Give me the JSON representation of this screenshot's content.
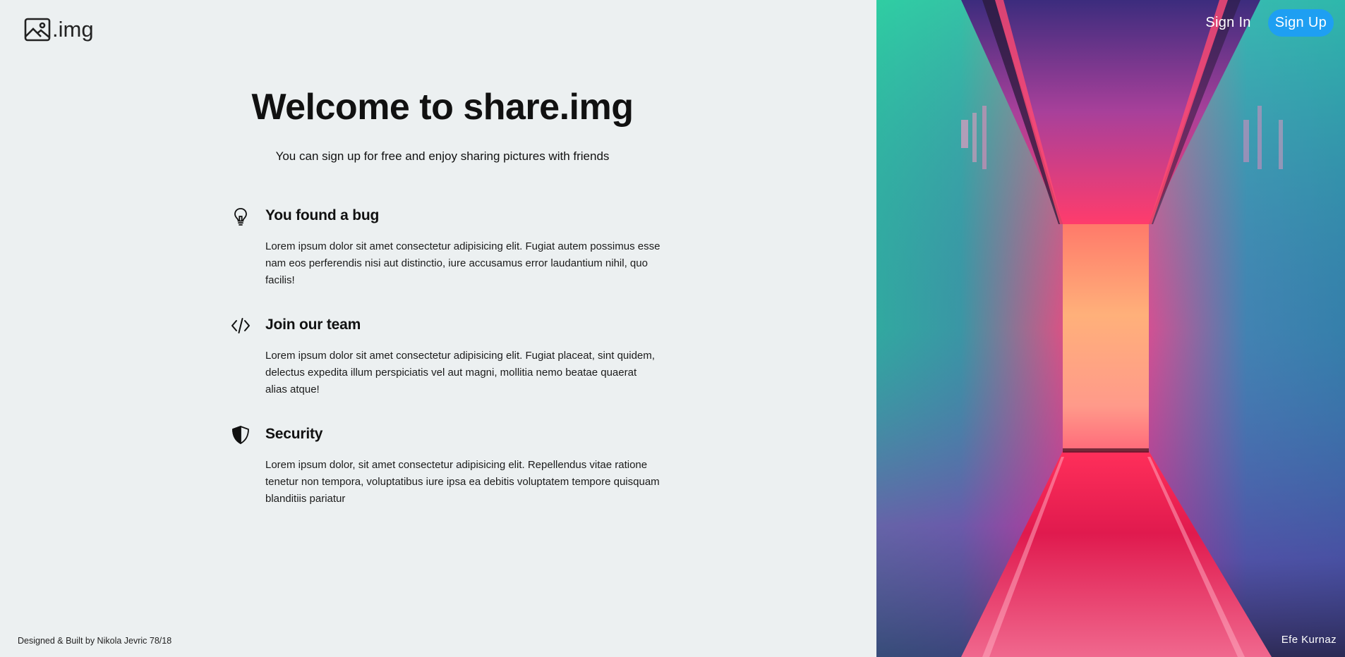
{
  "brand": {
    "logo_text": ".img"
  },
  "hero": {
    "title": "Welcome to share.img",
    "subtitle": "You can sign up for free and enjoy sharing pictures with friends"
  },
  "features": [
    {
      "icon": "lightbulb-icon",
      "title": "You found a bug",
      "text": "Lorem ipsum dolor sit amet consectetur adipisicing elit. Fugiat autem possimus esse nam eos perferendis nisi aut distinctio, iure accusamus error laudantium nihil, quo facilis!"
    },
    {
      "icon": "code-icon",
      "title": "Join our team",
      "text": "Lorem ipsum dolor sit amet consectetur adipisicing elit. Fugiat placeat, sint quidem, delectus expedita illum perspiciatis vel aut magni, mollitia nemo beatae quaerat alias atque!"
    },
    {
      "icon": "shield-icon",
      "title": "Security",
      "text": "Lorem ipsum dolor, sit amet consectetur adipisicing elit. Repellendus vitae ratione tenetur non tempora, voluptatibus iure ipsa ea debitis voluptatem tempore quisquam blanditiis pariatur"
    }
  ],
  "nav": {
    "sign_in": "Sign In",
    "sign_up": "Sign Up"
  },
  "footer": {
    "text": "Designed & Built by Nikola Jevric 78/18"
  },
  "photo": {
    "credit": "Efe Kurnaz"
  },
  "colors": {
    "background": "#ecf0f1",
    "accent": "#1e9ff2"
  }
}
